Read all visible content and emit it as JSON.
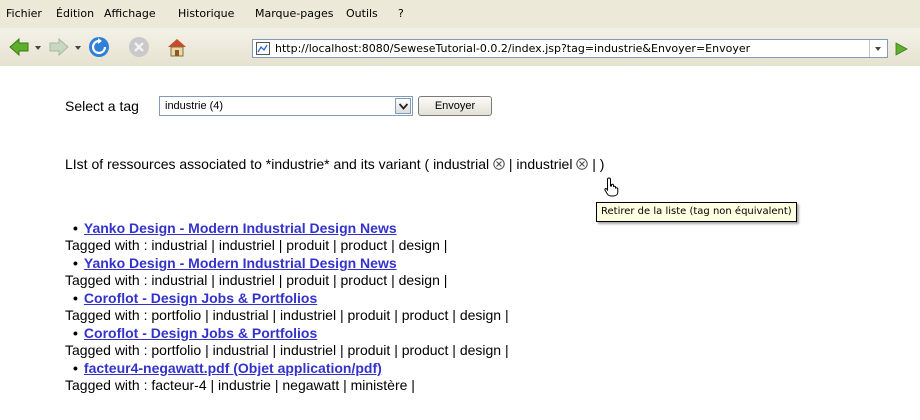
{
  "menubar": {
    "items": [
      {
        "label": "Fichier"
      },
      {
        "label": "Édition"
      },
      {
        "label": "Affichage"
      },
      {
        "label": "Historique"
      },
      {
        "label": "Marque-pages"
      },
      {
        "label": "Outils"
      },
      {
        "label": "?"
      }
    ]
  },
  "toolbar": {
    "icons": [
      "back-arrow-icon",
      "forward-arrow-icon",
      "reload-icon",
      "stop-icon",
      "home-icon",
      "go-arrow-icon"
    ],
    "url": "http://localhost:8080/SeweseTutorial-0.0.2/index.jsp?tag=industrie&Envoyer=Envoyer"
  },
  "form": {
    "label": "Select a tag",
    "selected_value": "industrie (4)",
    "submit_label": "Envoyer"
  },
  "list": {
    "heading_before": "LIst of ressources associated to *industrie* and its variant ( industrial",
    "separator": "| industriel",
    "heading_after": "| )",
    "tooltip": "Retirer de la liste (tag non équivalent)"
  },
  "results": [
    {
      "title": "Yanko Design - Modern Industrial Design News",
      "tags": "Tagged with : industrial | industriel | produit | product | design |"
    },
    {
      "title": "Yanko Design - Modern Industrial Design News",
      "tags": "Tagged with : industrial | industriel | produit | product | design |"
    },
    {
      "title": "Coroflot - Design Jobs & Portfolios",
      "tags": "Tagged with : portfolio | industrial | industriel | produit | product | design |"
    },
    {
      "title": "Coroflot - Design Jobs & Portfolios",
      "tags": "Tagged with : portfolio | industrial | industriel | produit | product | design |"
    },
    {
      "title": "facteur4-negawatt.pdf (Objet application/pdf)",
      "tags": "Tagged with : facteur-4 | industrie | negawatt | ministère |"
    }
  ],
  "colors": {
    "link": "#3333cc",
    "chrome_bg": "#ece9d8",
    "tooltip_bg": "#ffffe1"
  }
}
